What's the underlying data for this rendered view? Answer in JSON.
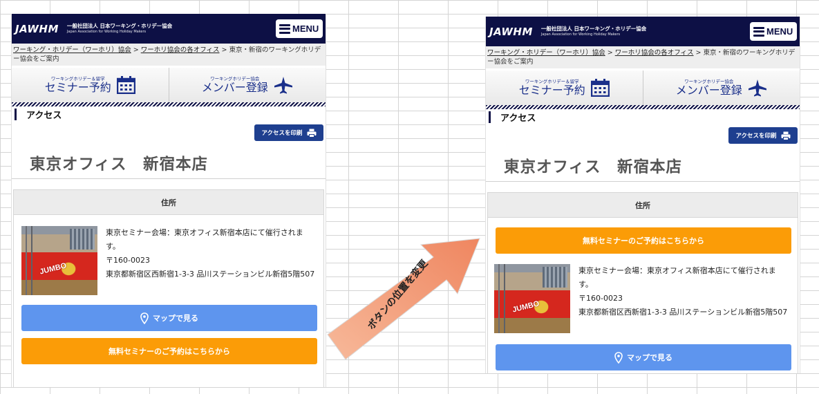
{
  "header": {
    "logo": "JAWHM",
    "org_line1": "一般社団法人 日本ワーキング・ホリデー協会",
    "org_line2": "Japan Association for Working Holiday Makers",
    "menu_label": "MENU"
  },
  "breadcrumb": {
    "item1": "ワーキング・ホリデー（ワーホリ）協会",
    "sep": " > ",
    "item2": "ワーホリ協会の各オフィス",
    "current": "東京・新宿のワーキングホリデー協会をご案内"
  },
  "tiles": {
    "seminar_sub": "ワーキングホリデー＆留学",
    "seminar_main": "セミナー予約",
    "member_sub": "ワーキングホリデー協会",
    "member_main": "メンバー登録"
  },
  "access": {
    "label": "アクセス",
    "print_label": "アクセスを印刷"
  },
  "office_title": "東京オフィス　新宿本店",
  "address": {
    "heading": "住所",
    "line1": "東京セミナー会場：東京オフィス新宿本店にて催行されます。",
    "line2": "〒160-0023",
    "line3": "東京都新宿区西新宿1-3-3 品川ステーションビル新宿5階507",
    "photo_sign": "JUMBO"
  },
  "buttons": {
    "map_label": "マップで見る",
    "seminar_label": "無料セミナーのご予約はこちらから"
  },
  "annotation": {
    "arrow_text": "ボタンの位置を変更"
  },
  "colors": {
    "header_bg": "#0d1045",
    "map_button": "#5e95ee",
    "seminar_button": "#fb9c07",
    "print_button": "#1e3f8f",
    "arrow_fill": "#f4a582"
  },
  "icons": [
    "menu-icon",
    "calendar-icon",
    "airplane-icon",
    "printer-icon",
    "map-pin-icon"
  ]
}
